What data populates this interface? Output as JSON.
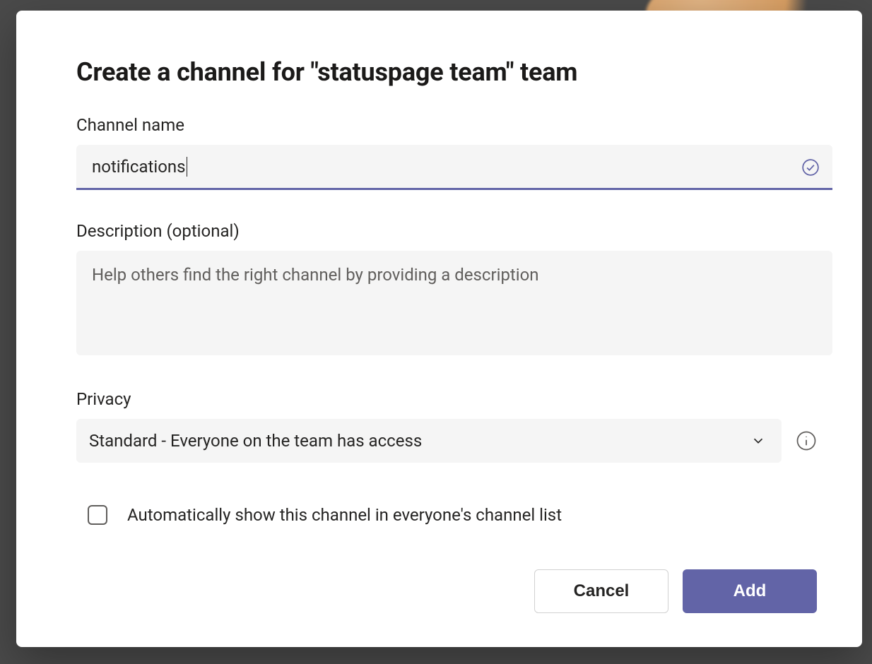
{
  "dialog": {
    "title": "Create a channel for \"statuspage team\" team",
    "channelName": {
      "label": "Channel name",
      "value": "notifications",
      "validIcon": "checkmark-circle"
    },
    "description": {
      "label": "Description (optional)",
      "placeholder": "Help others find the right channel by providing a description",
      "value": ""
    },
    "privacy": {
      "label": "Privacy",
      "selected": "Standard - Everyone on the team has access",
      "infoIcon": "info-circle"
    },
    "autoShow": {
      "checked": false,
      "label": "Automatically show this channel in everyone's channel list"
    },
    "buttons": {
      "cancel": "Cancel",
      "add": "Add"
    }
  },
  "colors": {
    "accent": "#6264a7",
    "surface": "#f5f5f5",
    "text": "#252423"
  }
}
